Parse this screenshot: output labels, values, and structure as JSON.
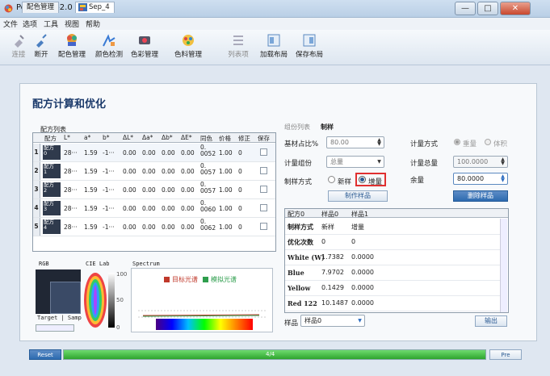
{
  "window": {
    "title": "PeColorPro2.0",
    "controls": {
      "minimize": "—",
      "maximize": "□",
      "close": "✕"
    }
  },
  "menu": [
    "文件",
    "选项",
    "工具",
    "视图",
    "帮助"
  ],
  "toolbar": {
    "items": [
      {
        "label": "连接",
        "icon": "plug-icon",
        "enabled": false
      },
      {
        "label": "断开",
        "icon": "unplug-icon",
        "enabled": true
      },
      {
        "label": "配色管理",
        "icon": "paint-bucket-icon",
        "enabled": true
      },
      {
        "label": "颜色检测",
        "icon": "color-check-icon",
        "enabled": true
      },
      {
        "label": "色彩管理",
        "icon": "color-manage-icon",
        "enabled": true
      },
      {
        "label": "色料管理",
        "icon": "pigment-icon",
        "enabled": true
      },
      {
        "label": "列表项",
        "icon": "list-icon",
        "enabled": false
      },
      {
        "label": "加载布局",
        "icon": "load-layout-icon",
        "enabled": true
      },
      {
        "label": "保存布局",
        "icon": "save-layout-icon",
        "enabled": true
      }
    ]
  },
  "tabs": [
    {
      "label": "配色管理",
      "active": false
    },
    {
      "label": "Sep_4",
      "active": true
    }
  ],
  "page": {
    "title": "配方计算和优化",
    "formula_list_label": "配方列表"
  },
  "formula_table": {
    "headers": [
      "配方",
      "L*",
      "a*",
      "b*",
      "ΔL*",
      "Δa*",
      "Δb*",
      "ΔE*",
      "同色",
      "价格",
      "修正",
      "保存"
    ],
    "rows": [
      {
        "index": "1",
        "name": "配方\n0",
        "L": "28···",
        "a": "1.59",
        "b": "-1···",
        "dL": "0.00",
        "da": "0.00",
        "db": "0.00",
        "dE": "0.00",
        "meta": "0.\n0052",
        "price": "1.00",
        "fix": "0"
      },
      {
        "index": "2",
        "name": "配方\n1",
        "L": "28···",
        "a": "1.59",
        "b": "-1···",
        "dL": "0.00",
        "da": "0.00",
        "db": "0.00",
        "dE": "0.00",
        "meta": "0.\n0057",
        "price": "1.00",
        "fix": "0"
      },
      {
        "index": "3",
        "name": "配方\n2",
        "L": "28···",
        "a": "1.59",
        "b": "-1···",
        "dL": "0.00",
        "da": "0.00",
        "db": "0.00",
        "dE": "0.00",
        "meta": "0.\n0057",
        "price": "1.00",
        "fix": "0"
      },
      {
        "index": "4",
        "name": "配方\n3",
        "L": "28···",
        "a": "1.59",
        "b": "-1···",
        "dL": "0.00",
        "da": "0.00",
        "db": "0.00",
        "dE": "0.00",
        "meta": "0.\n0060",
        "price": "1.00",
        "fix": "0"
      },
      {
        "index": "5",
        "name": "配方\n4",
        "L": "28···",
        "a": "1.59",
        "b": "-1···",
        "dL": "0.00",
        "da": "0.00",
        "db": "0.00",
        "dE": "0.00",
        "meta": "0.\n0062",
        "price": "1.00",
        "fix": "0"
      }
    ]
  },
  "panels": {
    "rgb_label": "RGB",
    "cie_label": "CIE Lab",
    "spectrum_label": "Spectrum",
    "target_sample": "Target | Samp",
    "legend_target": "目标光谱",
    "legend_sim": "模拟光谱",
    "cie_ticks": [
      "100",
      "50",
      "0"
    ],
    "colors": {
      "target": "#222a36",
      "sample": "#3a4a66",
      "target_line": "#c0392b",
      "sim_line": "#2e9e4d"
    }
  },
  "right": {
    "tab_group": "组份列表",
    "tab_make": "制样",
    "base_ratio_label": "基材占比%",
    "base_ratio_value": "80.00",
    "calc_group_label": "计量组份",
    "calc_group_value": "总量",
    "make_method_label": "制样方式",
    "method_new": "新样",
    "method_add": "增量",
    "make_sample_btn": "制作样品",
    "calc_mode_label": "计量方式",
    "mode_weight": "重量",
    "mode_volume": "体积",
    "calc_total_label": "计量总量",
    "calc_total_value": "100.0000",
    "remaining_label": "余量",
    "remaining_value": "80.0000",
    "delete_sample_btn": "删除样品",
    "sample_label": "样品",
    "sample_value": "样品0",
    "export_btn": "输出"
  },
  "result_table": {
    "headers": [
      "配方0",
      "样品0",
      "样品1"
    ],
    "rows": [
      {
        "name": "制样方式",
        "v1": "新样",
        "v2": "增量"
      },
      {
        "name": "优化次数",
        "v1": "0",
        "v2": "0"
      },
      {
        "name": "White (W)",
        "v1": "1.7382",
        "v2": "0.0000"
      },
      {
        "name": "Blue",
        "v1": "7.9702",
        "v2": "0.0000"
      },
      {
        "name": "Yellow",
        "v1": "0.1429",
        "v2": "0.0000"
      },
      {
        "name": "Red 122",
        "v1": "10.1487",
        "v2": "0.0000"
      }
    ]
  },
  "statusbar": {
    "reset_btn": "Reset",
    "progress_text": "4/4",
    "progress": 1.0,
    "pre_btn": "Pre"
  }
}
